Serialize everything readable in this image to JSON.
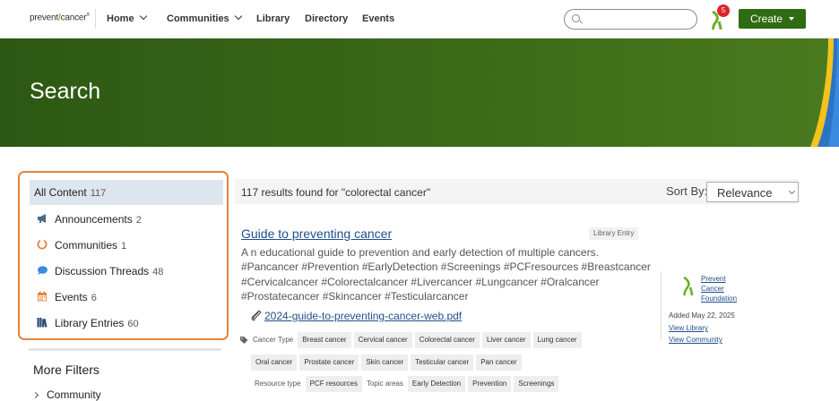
{
  "nav": {
    "logo_left": "prevent",
    "logo_right": "cancer",
    "logo_tm": "®",
    "items": [
      {
        "label": "Home",
        "has_dropdown": true
      },
      {
        "label": "Communities",
        "has_dropdown": true
      },
      {
        "label": "Library",
        "has_dropdown": false
      },
      {
        "label": "Directory",
        "has_dropdown": false
      },
      {
        "label": "Events",
        "has_dropdown": false
      }
    ],
    "search_placeholder": "",
    "notification_count": "5",
    "create_label": "Create"
  },
  "banner": {
    "title": "Search"
  },
  "filters": {
    "items": [
      {
        "label": "All Content",
        "count": "117",
        "icon": "none"
      },
      {
        "label": "Announcements",
        "count": "2",
        "icon": "megaphone-icon"
      },
      {
        "label": "Communities",
        "count": "1",
        "icon": "circle-icon"
      },
      {
        "label": "Discussion Threads",
        "count": "48",
        "icon": "chat-bubble-icon"
      },
      {
        "label": "Events",
        "count": "6",
        "icon": "calendar-icon"
      },
      {
        "label": "Library Entries",
        "count": "60",
        "icon": "books-icon"
      }
    ],
    "more_filters_label": "More Filters",
    "community_label": "Community"
  },
  "results": {
    "summary": "117 results found for \"colorectal cancer\"",
    "sort_label": "Sort By:",
    "sort_value": "Relevance",
    "item": {
      "title": "Guide to preventing cancer",
      "type": "Library Entry",
      "description": "A n educational guide to prevention and early detection of multiple cancers. #Pancancer #Prevention #EarlyDetection #Screenings #PCFresources #Breastcancer #Cervicalcancer #Colorectalcancer #Livercancer #Lungcancer #Oralcancer #Prostatecancer #Skincancer #Testicularcancer",
      "attachment": "2024-guide-to-preventing-cancer-web.pdf",
      "cancer_type_label": "Cancer Type",
      "cancer_types_row1": [
        "Breast cancer",
        "Cervical cancer",
        "Colorectal cancer",
        "Liver cancer",
        "Lung cancer"
      ],
      "cancer_types_row2": [
        "Oral cancer",
        "Prostate cancer",
        "Skin cancer",
        "Testicular cancer",
        "Pan cancer"
      ],
      "resource_type_label": "Resource type",
      "resource_types": [
        "PCF resources"
      ],
      "topic_areas_label": "Topic areas",
      "topic_areas": [
        "Early Detection",
        "Prevention",
        "Screenings"
      ],
      "org_name_lines": [
        "Prevent",
        "Cancer",
        "Foundation"
      ],
      "added": "Added May 22, 2025",
      "view_library": "View Library",
      "view_community": "View Community"
    }
  },
  "colors": {
    "brand_green": "#2f6b12",
    "banner_green": "#3b6a18",
    "link_blue": "#1f4e8c",
    "highlight_orange": "#e8833a",
    "badge_red": "#d9262b"
  }
}
